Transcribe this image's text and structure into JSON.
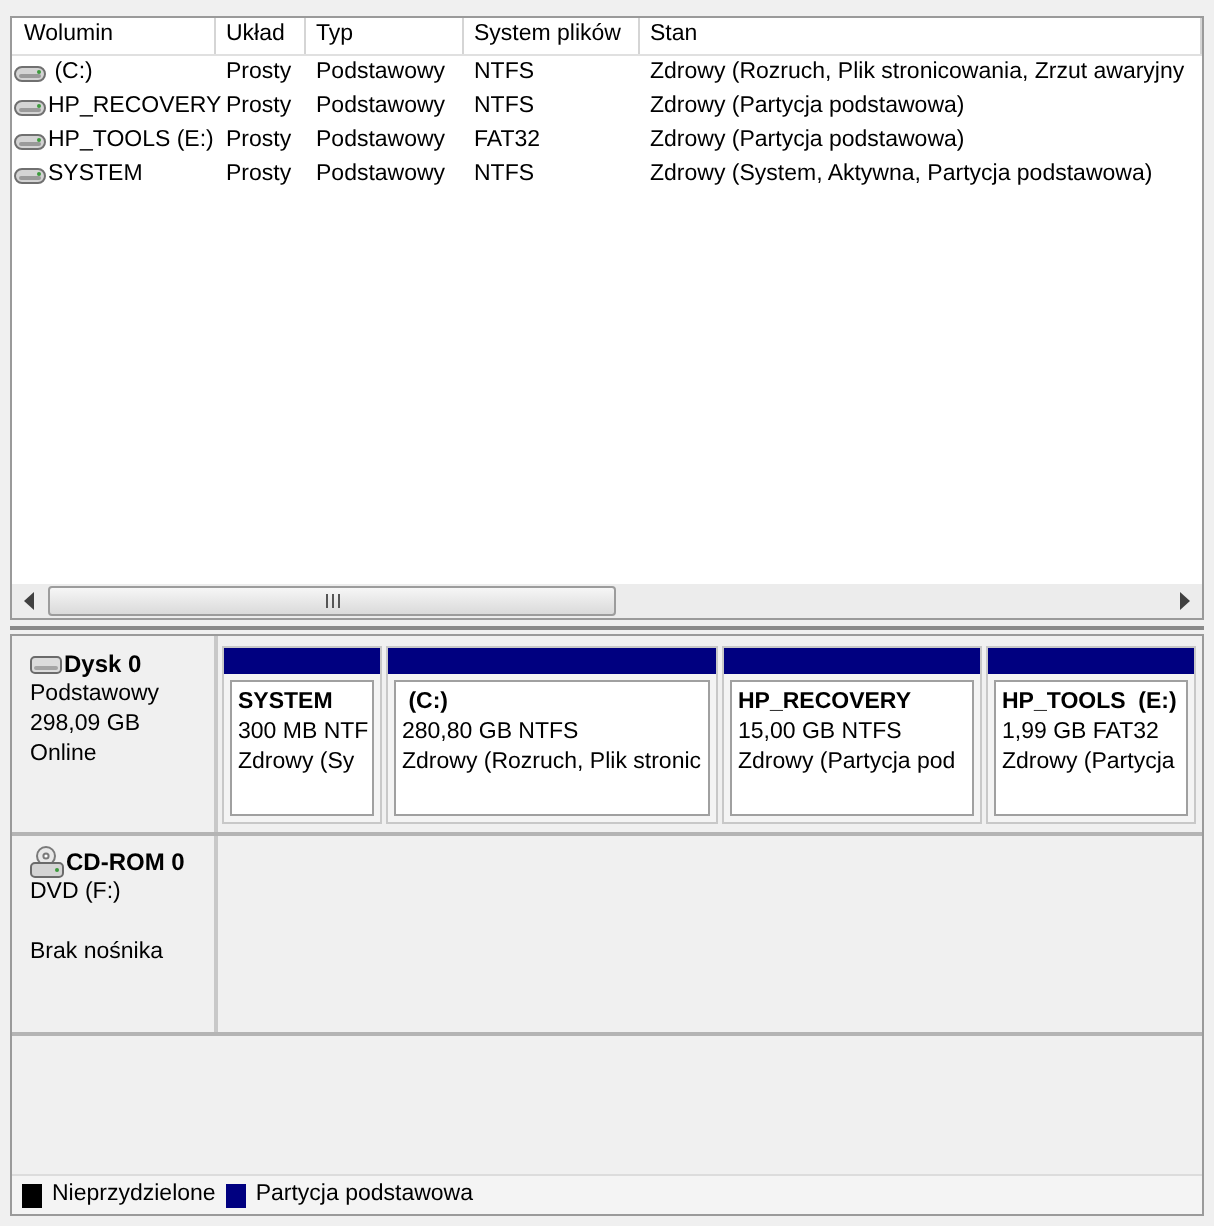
{
  "volume_list": {
    "columns": [
      "Wolumin",
      "Układ",
      "Typ",
      "System plików",
      "Stan"
    ],
    "rows": [
      {
        "cells": [
          " (C:)",
          "Prosty",
          "Podstawowy",
          "NTFS",
          "Zdrowy (Rozruch, Plik stronicowania, Zrzut awaryjny"
        ]
      },
      {
        "cells": [
          "HP_RECOVERY",
          "Prosty",
          "Podstawowy",
          "NTFS",
          "Zdrowy (Partycja podstawowa)"
        ]
      },
      {
        "cells": [
          "HP_TOOLS (E:)",
          "Prosty",
          "Podstawowy",
          "FAT32",
          "Zdrowy (Partycja podstawowa)"
        ]
      },
      {
        "cells": [
          "SYSTEM",
          "Prosty",
          "Podstawowy",
          "NTFS",
          "Zdrowy (System, Aktywna, Partycja podstawowa)"
        ]
      }
    ]
  },
  "disks": [
    {
      "kind": "disk",
      "name": "Dysk 0",
      "type": "Podstawowy",
      "capacity": "298,09 GB",
      "status": "Online",
      "partitions": [
        {
          "name": "SYSTEM",
          "size": "300 MB NTF",
          "status": "Zdrowy (Sy"
        },
        {
          "name": " (C:)",
          "size": "280,80 GB NTFS",
          "status": "Zdrowy (Rozruch, Plik stronic"
        },
        {
          "name": "HP_RECOVERY",
          "size": "15,00 GB NTFS",
          "status": "Zdrowy (Partycja pod"
        },
        {
          "name": "HP_TOOLS  (E:)",
          "size": "1,99 GB FAT32",
          "status": "Zdrowy (Partycja"
        }
      ]
    },
    {
      "kind": "cdrom",
      "name": "CD-ROM 0",
      "drive": "DVD (F:)",
      "status": "Brak nośnika"
    }
  ],
  "legend": [
    {
      "label": "Nieprzydzielone",
      "color": "#000000"
    },
    {
      "label": "Partycja podstawowa",
      "color": "#000080"
    }
  ]
}
